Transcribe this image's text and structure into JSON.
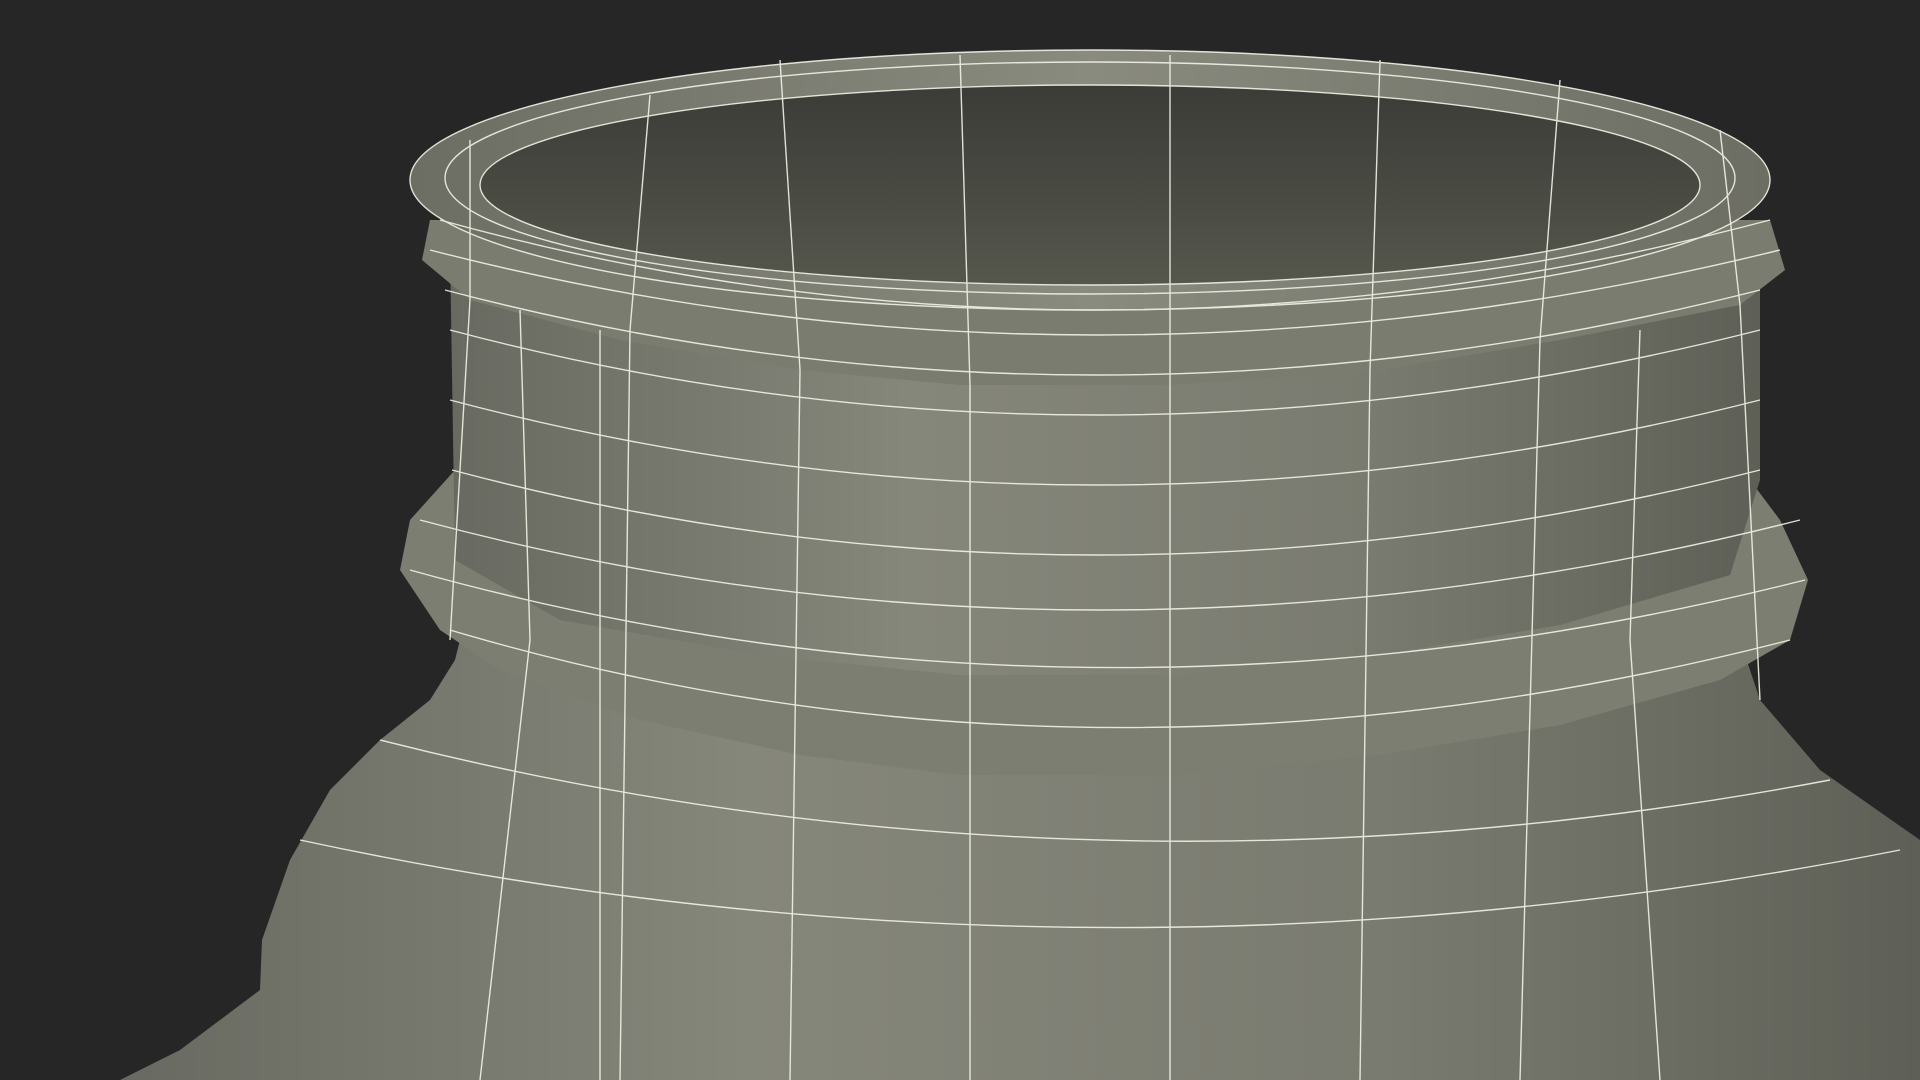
{
  "scene": {
    "subject": "3d-wireframe-bottle-neck",
    "colors": {
      "background": "#262626",
      "surface_light": "#85867a",
      "surface_mid": "#727367",
      "surface_dark": "#55564d",
      "inner_dark": "#3f403b",
      "wire": "#f2f2e6"
    }
  }
}
